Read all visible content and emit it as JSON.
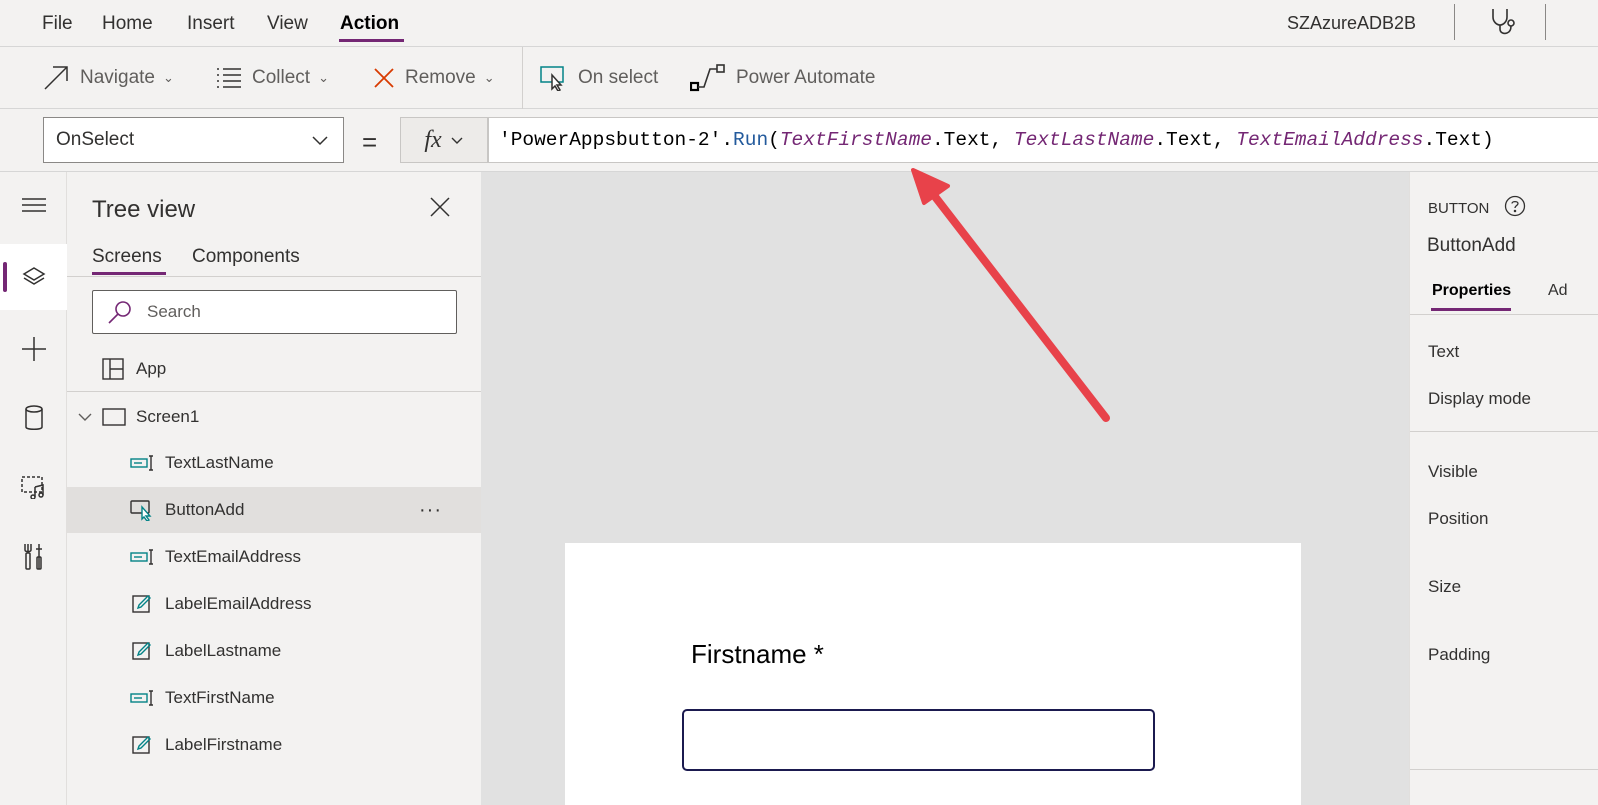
{
  "menu": {
    "items": [
      "File",
      "Home",
      "Insert",
      "View",
      "Action"
    ],
    "active": "Action",
    "environment": "SZAzureADB2B"
  },
  "toolbar": {
    "navigate": "Navigate",
    "collect": "Collect",
    "remove": "Remove",
    "on_select": "On select",
    "power_automate": "Power Automate"
  },
  "formula_bar": {
    "property": "OnSelect",
    "equals": "=",
    "fx": "fx",
    "formula_parts": {
      "p1": "'PowerAppsbutton-2'",
      "p2": ".",
      "p3": "Run",
      "p4": "(",
      "p5": "TextFirstName",
      "p6": ".Text, ",
      "p7": "TextLastName",
      "p8": ".Text, ",
      "p9": "TextEmailAddress",
      "p10": ".Text)"
    }
  },
  "rail": {
    "icons": [
      "hamburger-icon",
      "layers-icon",
      "plus-icon",
      "database-icon",
      "media-icon",
      "tools-icon"
    ],
    "active": "layers-icon"
  },
  "tree": {
    "title": "Tree view",
    "tabs": [
      "Screens",
      "Components"
    ],
    "active_tab": "Screens",
    "search_placeholder": "Search",
    "app_label": "App",
    "screen_label": "Screen1",
    "items": [
      {
        "label": "TextLastName",
        "icon": "text-input-icon"
      },
      {
        "label": "ButtonAdd",
        "icon": "button-icon",
        "selected": true
      },
      {
        "label": "TextEmailAddress",
        "icon": "text-input-icon"
      },
      {
        "label": "LabelEmailAddress",
        "icon": "label-edit-icon"
      },
      {
        "label": "LabelLastname",
        "icon": "label-edit-icon"
      },
      {
        "label": "TextFirstName",
        "icon": "text-input-icon"
      },
      {
        "label": "LabelFirstname",
        "icon": "label-edit-icon"
      }
    ],
    "more": "···"
  },
  "canvas": {
    "firstname_label": "Firstname *"
  },
  "properties": {
    "control_type": "BUTTON",
    "control_name": "ButtonAdd",
    "tabs": [
      "Properties",
      "Ad"
    ],
    "rows": [
      "Text",
      "Display mode",
      "Visible",
      "Position",
      "Size",
      "Padding"
    ]
  },
  "colors": {
    "accent": "#742774",
    "annotation_arrow": "#e8424a",
    "remove_icon": "#d83b01",
    "canvas_bg": "#e1e1e1"
  }
}
